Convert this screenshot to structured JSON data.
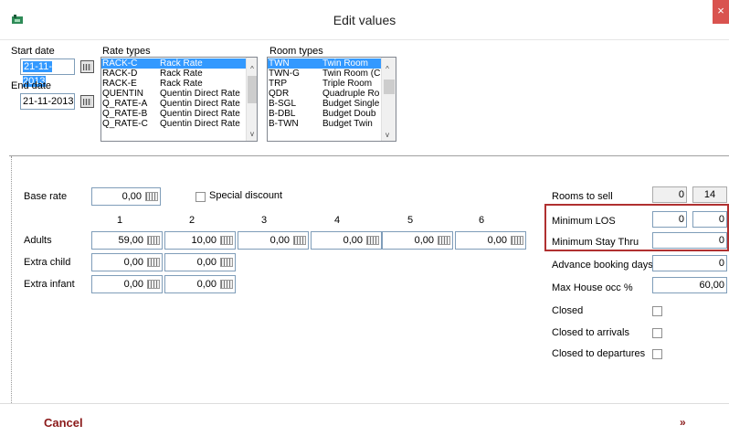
{
  "window": {
    "title": "Edit values",
    "close_label": "×"
  },
  "dates": {
    "start_label": "Start date",
    "start_value": "21-11-2013",
    "end_label": "End date",
    "end_value": "21-11-2013"
  },
  "rate_types": {
    "label": "Rate types",
    "selected_index": 0,
    "items": [
      {
        "code": "RACK-C",
        "name": "Rack Rate"
      },
      {
        "code": "RACK-D",
        "name": "Rack Rate"
      },
      {
        "code": "RACK-E",
        "name": "Rack Rate"
      },
      {
        "code": "QUENTIN",
        "name": "Quentin Direct Rate"
      },
      {
        "code": "Q_RATE-A",
        "name": "Quentin Direct Rate"
      },
      {
        "code": "Q_RATE-B",
        "name": "Quentin Direct Rate"
      },
      {
        "code": "Q_RATE-C",
        "name": "Quentin Direct Rate"
      }
    ]
  },
  "room_types": {
    "label": "Room types",
    "selected_index": 0,
    "items": [
      {
        "code": "TWN",
        "name": "Twin Room"
      },
      {
        "code": "TWN-G",
        "name": "Twin Room (C"
      },
      {
        "code": "TRP",
        "name": "Triple Room"
      },
      {
        "code": "QDR",
        "name": "Quadruple Ro"
      },
      {
        "code": "B-SGL",
        "name": "Budget Single"
      },
      {
        "code": "B-DBL",
        "name": "Budget Doub"
      },
      {
        "code": "B-TWN",
        "name": "Budget Twin"
      }
    ]
  },
  "scroll": {
    "up": "^",
    "down": "v"
  },
  "rates": {
    "base_rate_label": "Base rate",
    "base_rate_value": "0,00",
    "special_discount_label": "Special discount",
    "special_discount_checked": false,
    "columns": [
      "1",
      "2",
      "3",
      "4",
      "5",
      "6"
    ],
    "rows": [
      {
        "label": "Adults",
        "values": [
          "59,00",
          "10,00",
          "0,00",
          "0,00",
          "0,00",
          "0,00"
        ]
      },
      {
        "label": "Extra child",
        "values": [
          "0,00",
          "0,00"
        ]
      },
      {
        "label": "Extra infant",
        "values": [
          "0,00",
          "0,00"
        ]
      }
    ]
  },
  "right": {
    "rooms_to_sell_label": "Rooms to sell",
    "rooms_to_sell_value": "0",
    "rooms_to_sell_total": "14",
    "min_los_label": "Minimum LOS",
    "min_los_value_1": "0",
    "min_los_value_2": "0",
    "min_stay_thru_label": "Minimum Stay Thru",
    "min_stay_thru_value": "0",
    "advance_booking_label": "Advance booking days",
    "advance_booking_value": "0",
    "max_house_label": "Max House occ %",
    "max_house_value": "60,00",
    "closed_label": "Closed",
    "closed_arrivals_label": "Closed to arrivals",
    "closed_departures_label": "Closed to departures"
  },
  "footer": {
    "cancel_label": "Cancel",
    "next_label": "»"
  },
  "colors": {
    "selection": "#3399ff",
    "accent": "#8b1a1a",
    "highlight_border": "#b03030",
    "close_bg": "#d9534f"
  }
}
